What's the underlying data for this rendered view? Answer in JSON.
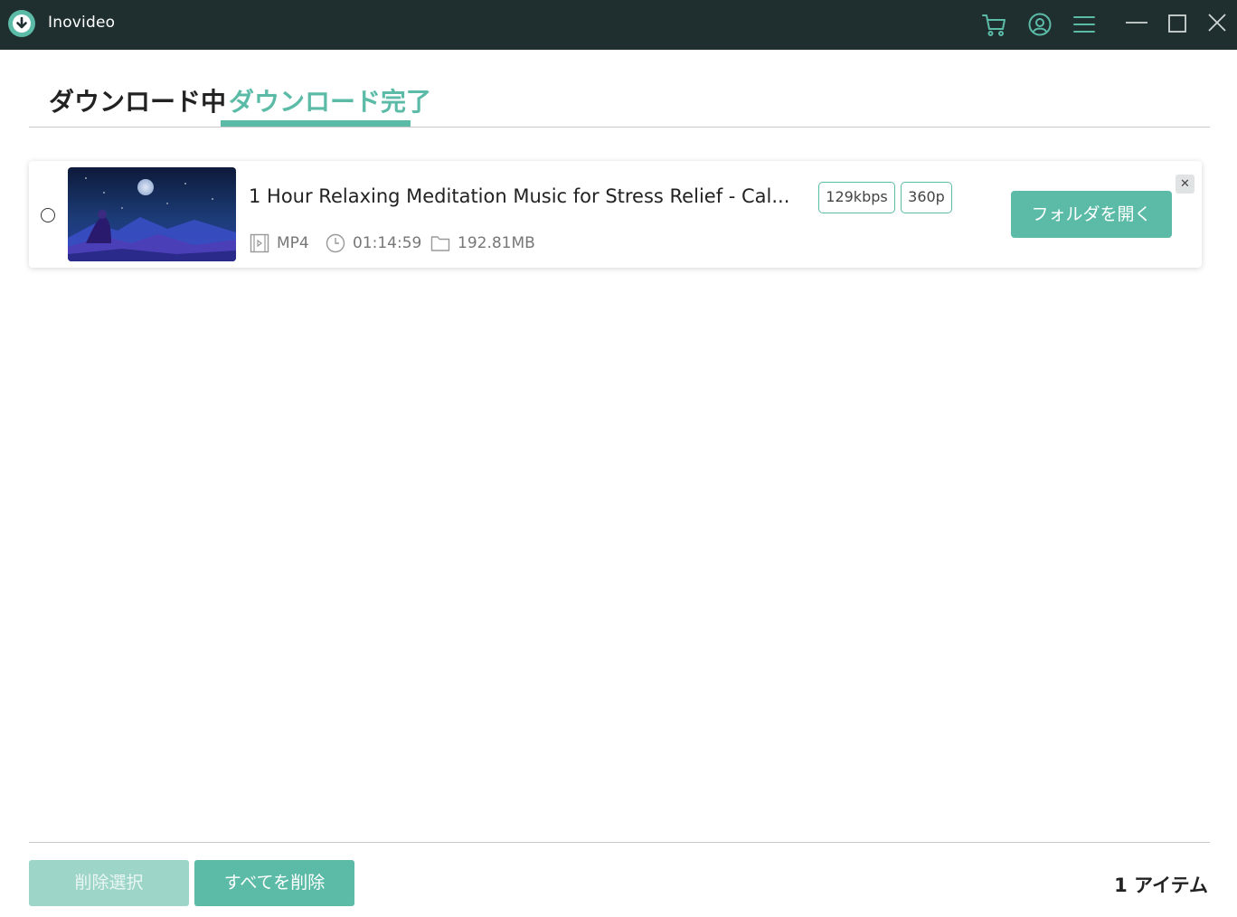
{
  "app": {
    "title": "Inovideo"
  },
  "titlebar": {
    "icons": [
      "download-logo-icon",
      "cart-icon",
      "account-icon",
      "menu-icon",
      "minimize-icon",
      "maximize-icon",
      "close-icon"
    ]
  },
  "tabs": [
    {
      "label": "ダウンロード中",
      "active": false
    },
    {
      "label": "ダウンロード完了",
      "active": true
    }
  ],
  "items": [
    {
      "title": "1 Hour Relaxing Meditation Music for Stress Relief - Cal...",
      "bitrate": "129kbps",
      "resolution": "360p",
      "format": "MP4",
      "duration": "01:14:59",
      "size": "192.81MB",
      "open_folder_label": "フォルダを開く",
      "selected": false
    }
  ],
  "footer": {
    "delete_selected_label": "削除選択",
    "delete_all_label": "すべてを削除",
    "item_count": "1 アイテム"
  },
  "colors": {
    "accent": "#5bbba7",
    "accent_disabled": "#9dd5c9",
    "titlebar_bg": "#1f2e2f"
  }
}
